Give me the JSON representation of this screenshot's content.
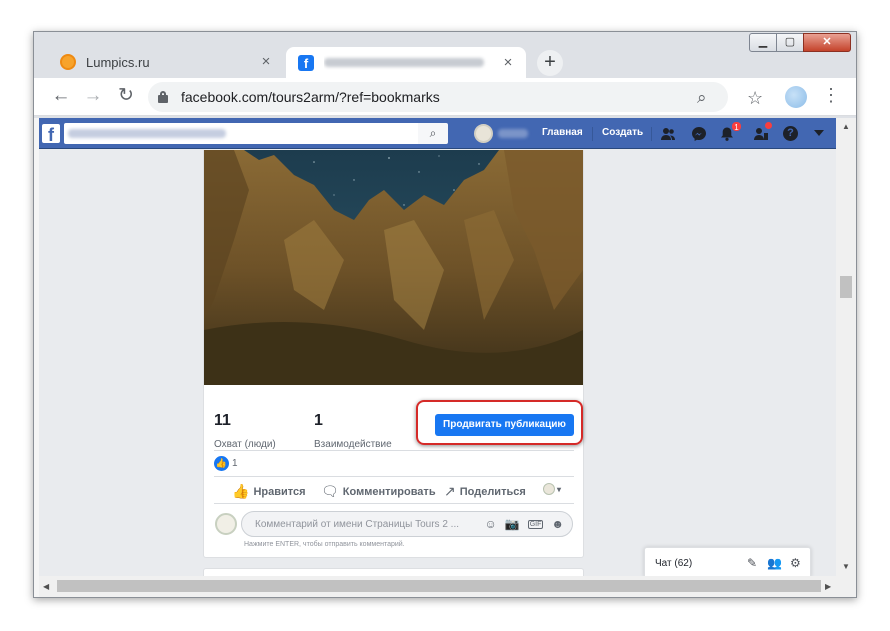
{
  "browser": {
    "tabs": [
      {
        "title": "Lumpics.ru",
        "close": "×"
      },
      {
        "title": "",
        "close": "×"
      }
    ],
    "new_tab_label": "+",
    "window_buttons": {
      "minimize": "▁",
      "maximize": "▢",
      "close": "✕"
    },
    "nav": {
      "back": "←",
      "forward": "→",
      "reload": "↻"
    },
    "url": "facebook.com/tours2arm/?ref=bookmarks",
    "menu_glyph": "⋮",
    "zoom_glyph": "⌕",
    "star_glyph": "☆"
  },
  "facebook": {
    "logo": "f",
    "search_glyph": "⌕",
    "nav": {
      "home": "Главная",
      "create": "Создать"
    },
    "notification_count": "1",
    "help_glyph": "?"
  },
  "post": {
    "stats": [
      {
        "value": "11",
        "label": "Охват (люди)"
      },
      {
        "value": "1",
        "label": "Взаимодействие"
      }
    ],
    "promote_button": "Продвигать публикацию",
    "likes_count": "1",
    "actions": {
      "like": "Нравится",
      "comment": "Комментировать",
      "share": "Поделиться"
    },
    "comment_placeholder": "Комментарий от имени Страницы Tours 2 ...",
    "comment_hint": "Нажмите ENTER, чтобы отправить комментарий."
  },
  "chat": {
    "label": "Чат (62)"
  },
  "colors": {
    "facebook_blue": "#4267b2",
    "button_blue": "#1877f2",
    "highlight_red": "#d52a28"
  }
}
